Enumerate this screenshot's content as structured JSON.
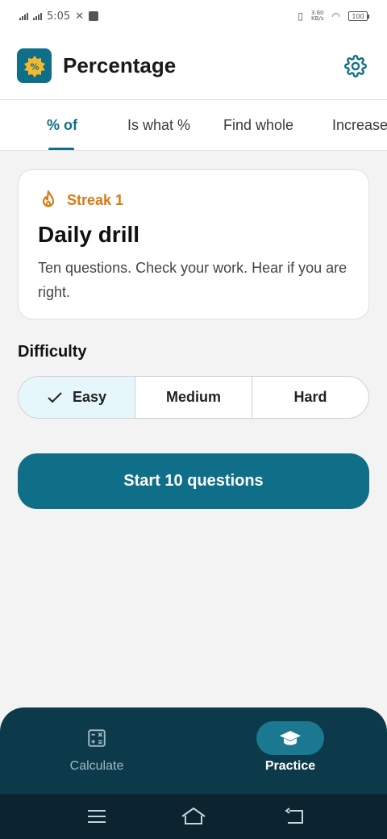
{
  "status_bar": {
    "time": "5:05",
    "network_speed_top": "3.60",
    "network_speed_bottom": "KB/s",
    "battery": "100"
  },
  "app_bar": {
    "title": "Percentage",
    "logo_symbol": "%"
  },
  "tabs": [
    {
      "label": "% of",
      "active": true
    },
    {
      "label": "Is what %",
      "active": false
    },
    {
      "label": "Find whole",
      "active": false
    },
    {
      "label": "Increase",
      "active": false
    }
  ],
  "card": {
    "streak": "Streak 1",
    "title": "Daily drill",
    "description": "Ten questions. Check your work. Hear if you are right."
  },
  "difficulty": {
    "label": "Difficulty",
    "options": [
      "Easy",
      "Medium",
      "Hard"
    ],
    "selected": "Easy"
  },
  "start_button": "Start 10 questions",
  "bottom_nav": {
    "items": [
      {
        "label": "Calculate",
        "icon": "calculator-icon",
        "active": false
      },
      {
        "label": "Practice",
        "icon": "graduation-cap-icon",
        "active": true
      }
    ]
  },
  "colors": {
    "primary": "#0f6e88",
    "streak": "#d97a12",
    "nav_bg": "#0d3a4a",
    "selected_segment": "#e6f7fb"
  }
}
